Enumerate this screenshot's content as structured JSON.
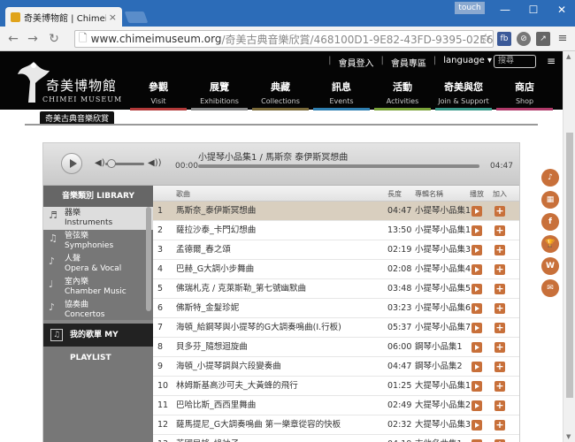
{
  "browser": {
    "tab_title": "奇美博物館 | Chimei Musi",
    "tab_close": "×",
    "touch_label": "touch",
    "url_domain": "www.chimeimuseum.org",
    "url_path": "/奇美古典音樂欣賞/468100D1-9E82-43FD-9395-02E613",
    "back_glyph": "←",
    "forward_glyph": "→",
    "reload_glyph": "↻",
    "star_glyph": "☆",
    "ext_fb": "fb",
    "win_min": "—",
    "win_max": "☐",
    "win_close": "✕"
  },
  "site": {
    "logo_cn": "奇美博物館",
    "logo_en": "CHIMEI MUSEUM",
    "top_links": [
      "會員登入",
      "會員專區",
      "language ▾"
    ],
    "search_placeholder": "搜尋",
    "nav": [
      {
        "zh": "參觀",
        "en": "Visit",
        "color": "#b23a3a"
      },
      {
        "zh": "展覽",
        "en": "Exhibitions",
        "color": "#8c8c8c"
      },
      {
        "zh": "典藏",
        "en": "Collections",
        "color": "#7a6a3a"
      },
      {
        "zh": "訊息",
        "en": "Events",
        "color": "#2f7fb0"
      },
      {
        "zh": "活動",
        "en": "Activities",
        "color": "#7aa33a"
      },
      {
        "zh": "奇美與您",
        "en": "Join & Support",
        "color": "#3a9a8a"
      },
      {
        "zh": "商店",
        "en": "Shop",
        "color": "#b03a6a"
      }
    ],
    "breadcrumb": "奇美古典音樂欣賞"
  },
  "player": {
    "now_playing": "小提琴小品集1 / 馬斯奈  泰伊斯冥想曲",
    "time_current": "00:00",
    "time_duration": "04:47"
  },
  "library": {
    "header": "音樂類別 LIBRARY",
    "items": [
      {
        "zh": "器樂",
        "en": "Instruments",
        "active": true
      },
      {
        "zh": "管弦樂",
        "en": "Symphonies",
        "active": false
      },
      {
        "zh": "人聲",
        "en": "Opera & Vocal",
        "active": false
      },
      {
        "zh": "室內樂",
        "en": "Chamber Music",
        "active": false
      },
      {
        "zh": "協奏曲",
        "en": "Concertos",
        "active": false
      }
    ],
    "playlist": "我的歌單 MY PLAYLIST"
  },
  "table": {
    "headers": {
      "title": "歌曲",
      "length": "長度",
      "album": "專輯名稱",
      "play": "播放",
      "add": "加入"
    },
    "rows": [
      {
        "no": "1",
        "title": "馬斯奈_泰伊斯冥想曲",
        "len": "04:47",
        "album": "小提琴小品集1"
      },
      {
        "no": "2",
        "title": "薩拉沙泰_卡門幻想曲",
        "len": "13:50",
        "album": "小提琴小品集1"
      },
      {
        "no": "3",
        "title": "孟德爾_春之頌",
        "len": "02:19",
        "album": "小提琴小品集3"
      },
      {
        "no": "4",
        "title": "巴赫_G大調小步舞曲",
        "len": "02:08",
        "album": "小提琴小品集4"
      },
      {
        "no": "5",
        "title": "佛瑞札克 / 克萊斯勒_第七號幽默曲",
        "len": "03:48",
        "album": "小提琴小品集5"
      },
      {
        "no": "6",
        "title": "佛斯特_金髮珍妮",
        "len": "03:23",
        "album": "小提琴小品集6"
      },
      {
        "no": "7",
        "title": "海頓_給鋼琴與小提琴的G大調奏鳴曲(I.行板)",
        "len": "05:37",
        "album": "小提琴小品集7"
      },
      {
        "no": "8",
        "title": "貝多芬_隨想迴旋曲",
        "len": "06:00",
        "album": "鋼琴小品集1"
      },
      {
        "no": "9",
        "title": "海頓_小提琴調與六段變奏曲",
        "len": "04:47",
        "album": "鋼琴小品集2"
      },
      {
        "no": "10",
        "title": "林姆斯基高沙可夫_大黃蜂的飛行",
        "len": "01:25",
        "album": "大提琴小品集1"
      },
      {
        "no": "11",
        "title": "巴哈比斯_西西里舞曲",
        "len": "02:49",
        "album": "大提琴小品集2"
      },
      {
        "no": "12",
        "title": "薩馬提尼_G大調奏鳴曲 第一樂章從容的快板",
        "len": "02:32",
        "album": "大提琴小品集3"
      },
      {
        "no": "13",
        "title": "英國民謠_綠袖子",
        "len": "04:19",
        "album": "吉他名曲集1"
      }
    ],
    "selected_row": 1
  },
  "social": [
    "♪",
    "▦",
    "f",
    "🏆",
    "W",
    "✉"
  ]
}
